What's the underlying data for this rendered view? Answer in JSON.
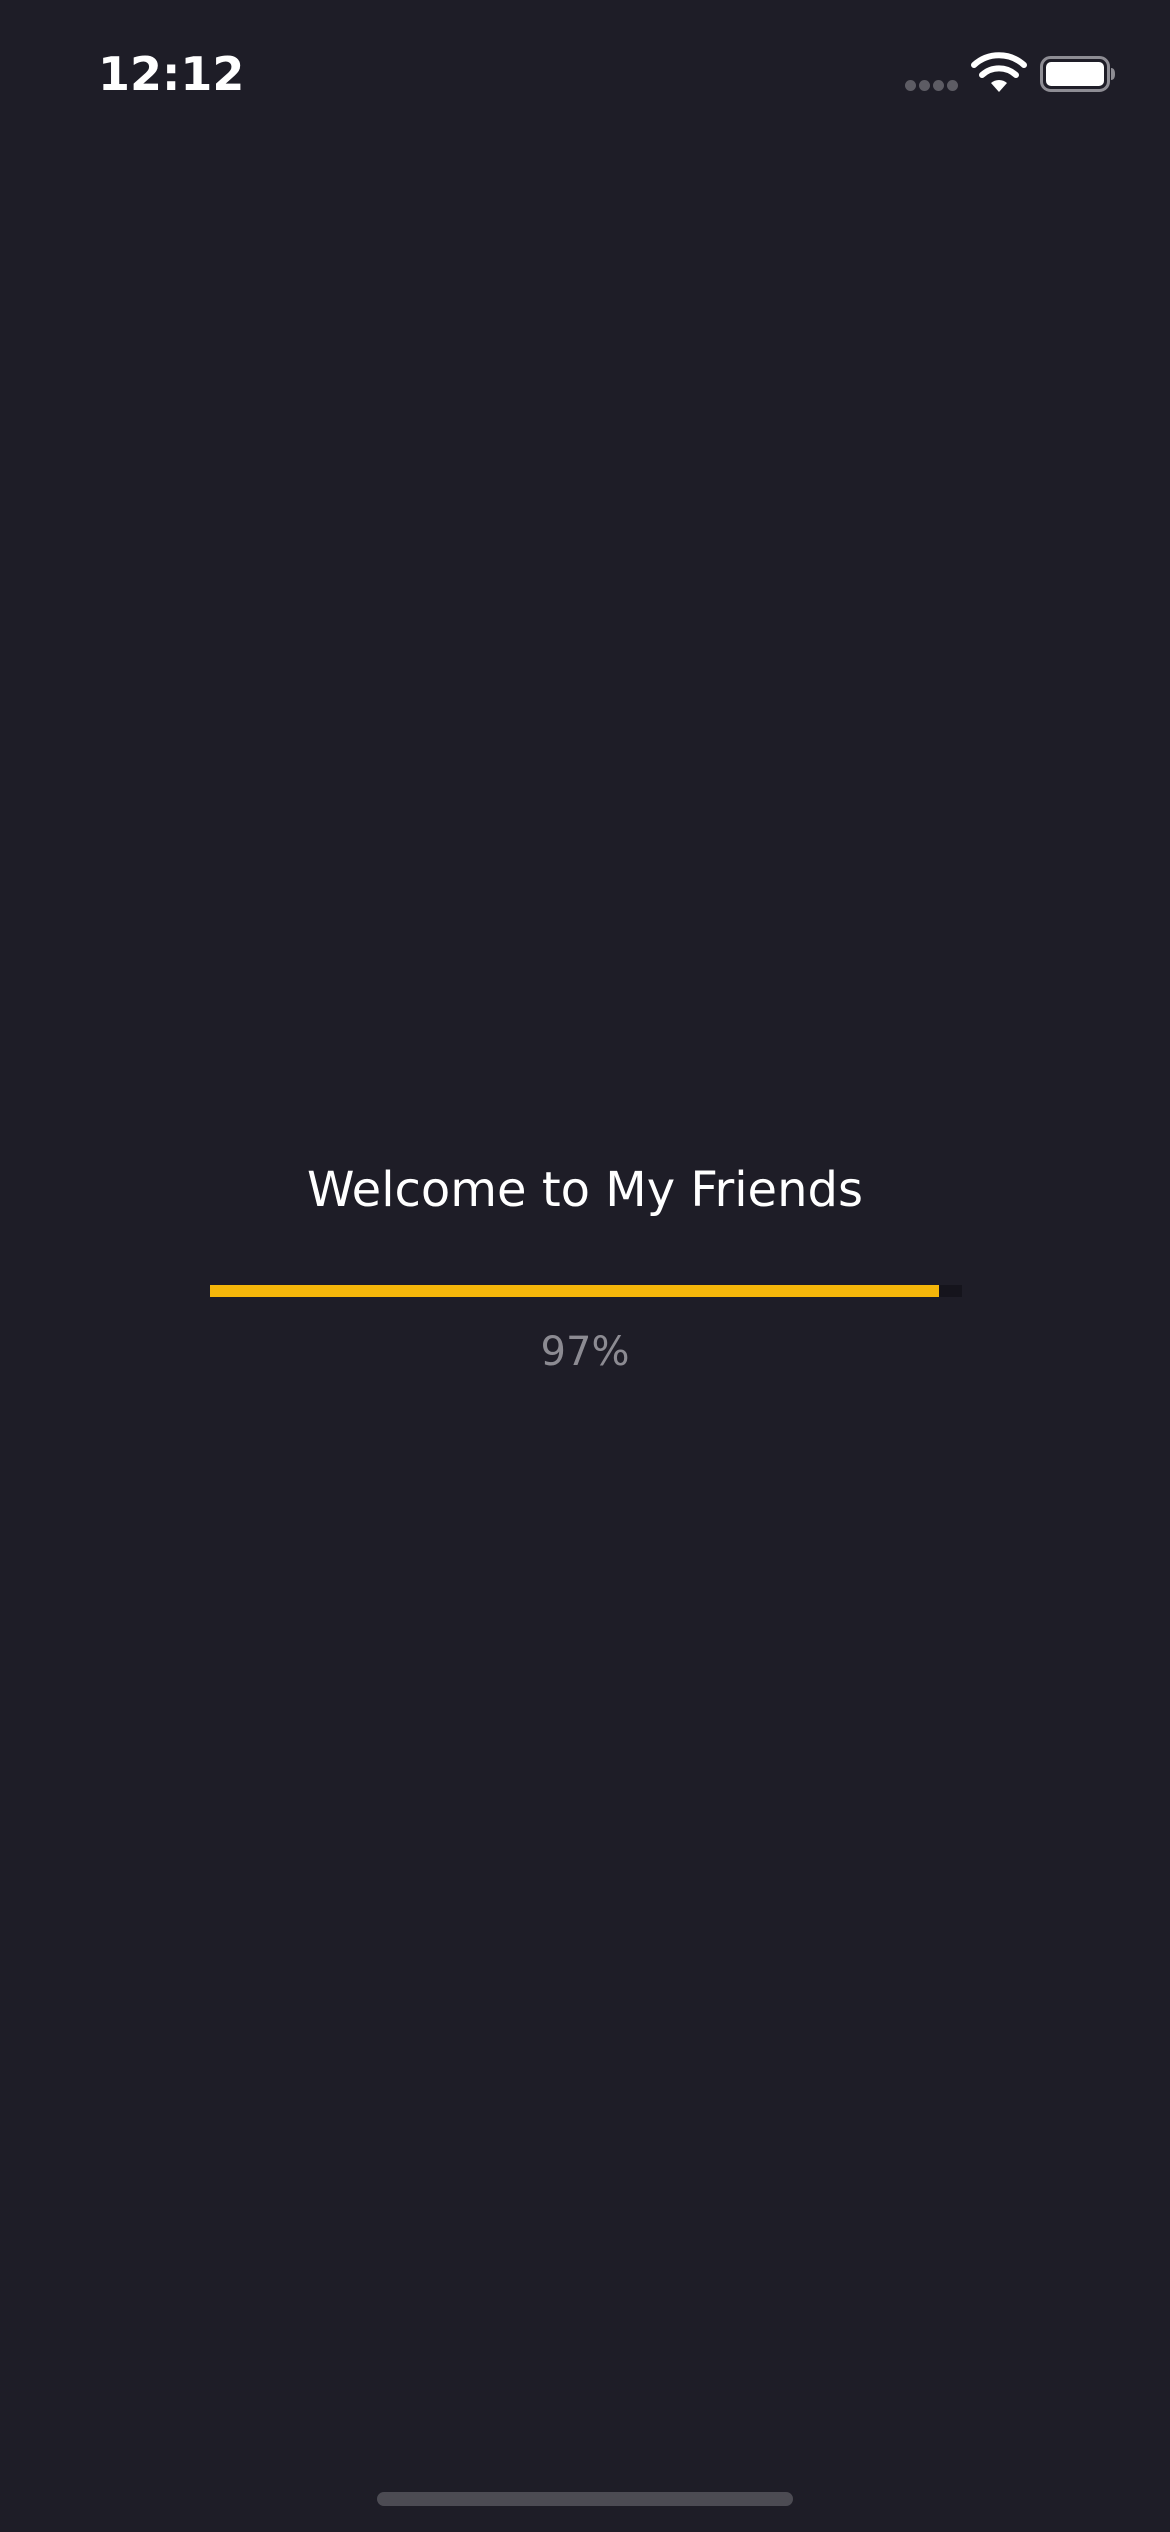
{
  "status_bar": {
    "time": "12:12",
    "icons": [
      "cellular-signal-icon",
      "wifi-icon",
      "battery-icon"
    ]
  },
  "splash": {
    "title": "Welcome to My Friends",
    "progress": {
      "percent_label": "97%",
      "value_percent": 97
    }
  },
  "colors": {
    "background": "#1e1d27",
    "accent": "#f5b60a",
    "percent_text": "#8c8b92"
  }
}
